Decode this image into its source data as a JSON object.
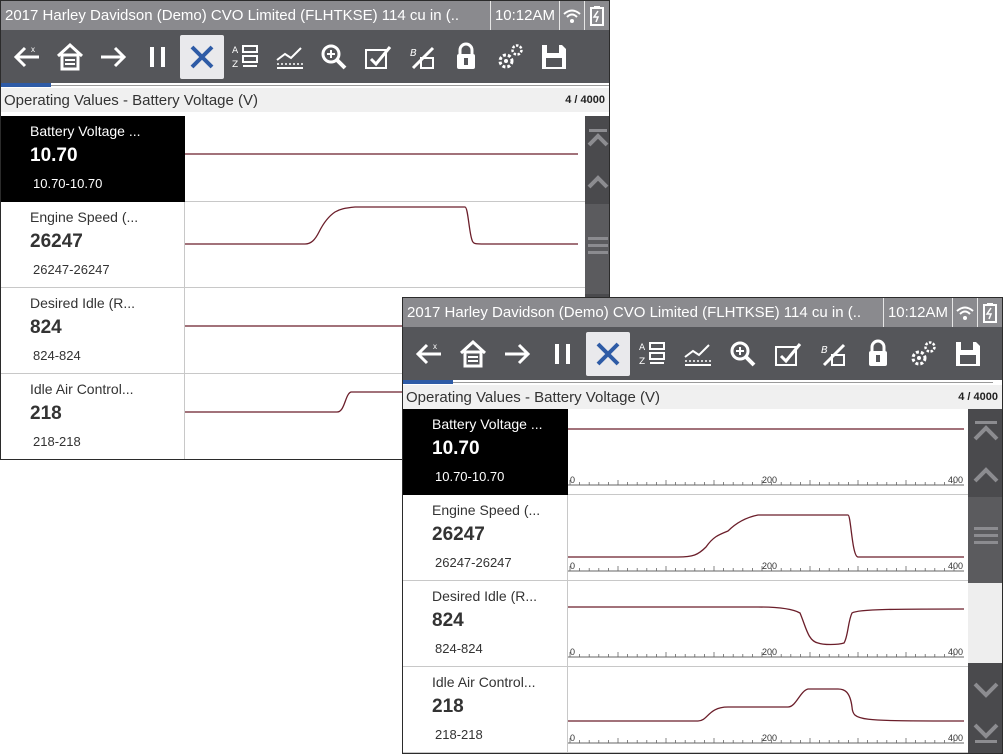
{
  "title_bar": {
    "text": "2017 Harley Davidson (Demo) CVO Limited (FLHTKSE) 114 cu in (..",
    "time": "10:12AM",
    "wifi_icon": "wifi-icon",
    "battery_icon": "battery-icon"
  },
  "toolbar": {
    "buttons": [
      {
        "name": "back-button",
        "icon": "back-arrow-icon"
      },
      {
        "name": "home-button",
        "icon": "home-icon"
      },
      {
        "name": "forward-button",
        "icon": "forward-arrow-icon"
      },
      {
        "name": "pause-button",
        "icon": "pause-icon"
      },
      {
        "name": "close-button",
        "icon": "close-icon",
        "active": true
      },
      {
        "name": "sort-button",
        "icon": "sort-icon"
      },
      {
        "name": "graph-button",
        "icon": "graph-icon"
      },
      {
        "name": "zoom-button",
        "icon": "zoom-icon"
      },
      {
        "name": "check-button",
        "icon": "check-icon"
      },
      {
        "name": "pids-button",
        "icon": "pids-icon"
      },
      {
        "name": "lock-button",
        "icon": "lock-icon"
      },
      {
        "name": "settings-button",
        "icon": "gear-icon"
      },
      {
        "name": "save-button",
        "icon": "save-icon"
      }
    ]
  },
  "header": {
    "title": "Operating Values - Battery Voltage (V)",
    "page_count": "4 / 4000"
  },
  "parameters": [
    {
      "name": "Battery Voltage ...",
      "value": "10.70",
      "range": "10.70-10.70",
      "selected": true
    },
    {
      "name": "Engine Speed (...",
      "value": "26247",
      "range": "26247-26247",
      "selected": false
    },
    {
      "name": "Desired Idle (R...",
      "value": "824",
      "range": "824-824",
      "selected": false
    },
    {
      "name": "Idle Air Control...",
      "value": "218",
      "range": "218-218",
      "selected": false
    }
  ],
  "axis_labels": [
    "0",
    "200",
    "400"
  ],
  "colors": {
    "titlebar": "#8a8a8e",
    "toolbar": "#55565a",
    "trace": "#6b1e2a",
    "selected_bg": "#000000",
    "scroll": "#4a4a4d"
  }
}
